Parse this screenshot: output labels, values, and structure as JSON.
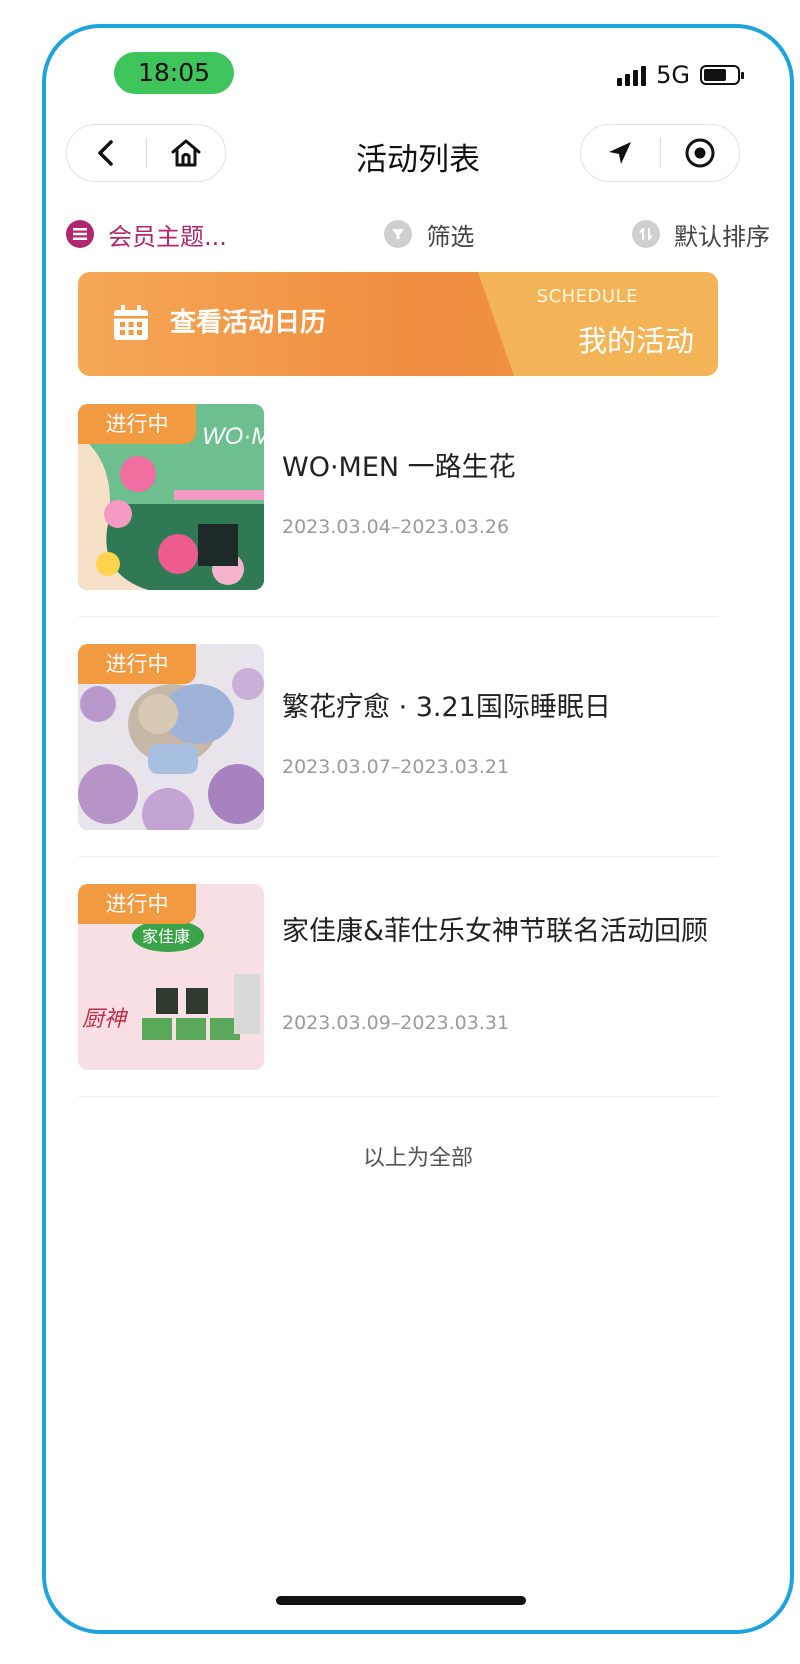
{
  "status": {
    "time": "18:05",
    "network": "5G"
  },
  "nav": {
    "title": "活动列表"
  },
  "filters": {
    "theme": "会员主题...",
    "filter": "筛选",
    "sort": "默认排序"
  },
  "banner": {
    "calendar_label": "查看活动日历",
    "schedule_label": "SCHEDULE",
    "my_activities": "我的活动"
  },
  "activities": [
    {
      "status": "进行中",
      "title": "WO·MEN 一路生花",
      "date": "2023.03.04–2023.03.26",
      "thumb_text": "WO·M 一路"
    },
    {
      "status": "进行中",
      "title": "繁花疗愈 · 3.21国际睡眠日",
      "date": "2023.03.07–2023.03.21"
    },
    {
      "status": "进行中",
      "title": "家佳康&菲仕乐女神节联名活动回顾",
      "date": "2023.03.09–2023.03.31",
      "thumb_text_1": "家佳康",
      "thumb_text_2": "厨神"
    }
  ],
  "footer_note": "以上为全部",
  "colors": {
    "accent_orange": "#f29a3f",
    "theme_magenta": "#b0276e",
    "frame_blue": "#1fa3dc",
    "status_green": "#3fc45c"
  }
}
